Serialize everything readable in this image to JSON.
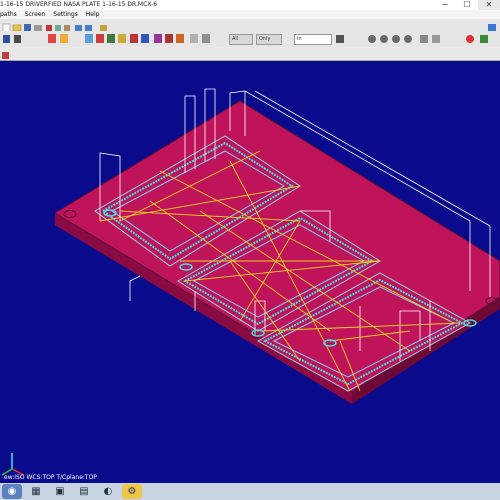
{
  "window": {
    "title": "1-16-15 DRIVERFIED NASA PLATE 1-16-15 DR.MCX-6",
    "minimize_glyph": "−",
    "maximize_glyph": "☐",
    "close_glyph": "✕"
  },
  "menu": {
    "items": [
      "paths",
      "Screen",
      "Settings",
      "Help"
    ]
  },
  "toolbar": {
    "all_label": "All",
    "only_label": "Only",
    "level_value": "In"
  },
  "status": {
    "text": "ew:ISO  WCS:TOP  T/Cplane:TOP"
  },
  "colors": {
    "background": "#0a0a8c",
    "plate": "#c0145a",
    "plate_side": "#8a0b42",
    "toolpath_cyan": "#41e1e6",
    "toolpath_yellow": "#f0d020",
    "rapid_white": "#ffffff"
  },
  "icons": [
    "windows-start-icon",
    "file-explorer-icon",
    "mastercam-icon",
    "calculator-icon",
    "folder-icon",
    "gear-icon",
    "axis-triad-icon"
  ]
}
